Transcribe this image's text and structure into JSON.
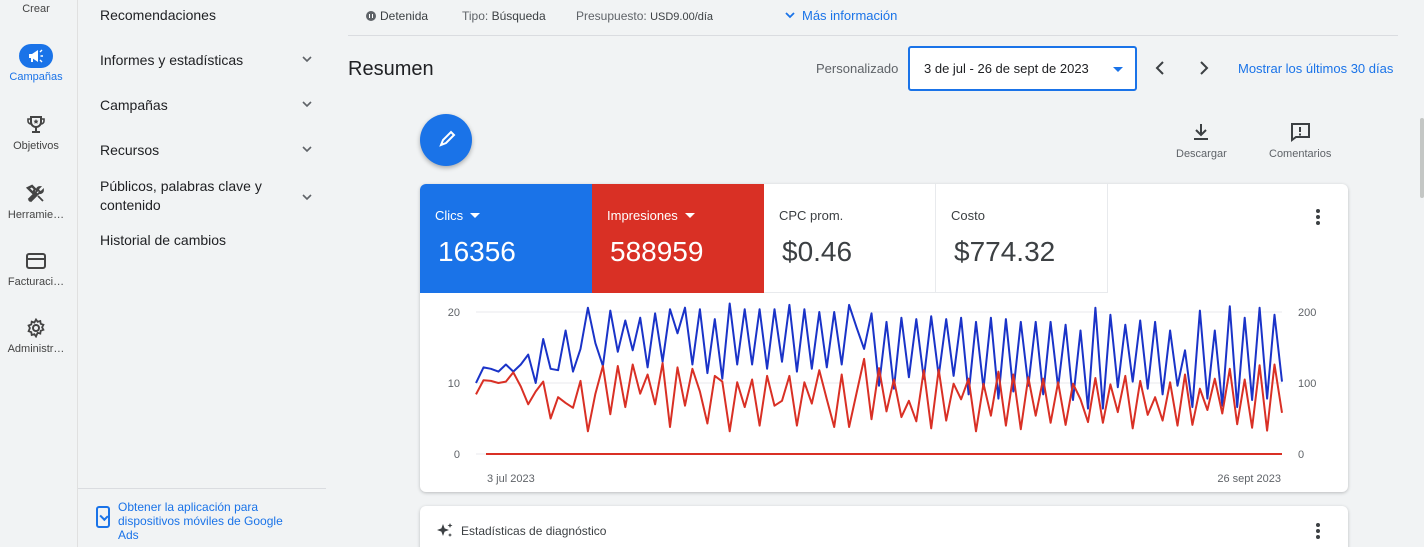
{
  "rail": {
    "items": [
      {
        "label": "Crear",
        "icon": "plus-icon"
      },
      {
        "label": "Campañas",
        "icon": "megaphone-icon"
      },
      {
        "label": "Objetivos",
        "icon": "trophy-icon"
      },
      {
        "label": "Herramie…",
        "icon": "tools-icon"
      },
      {
        "label": "Facturaci…",
        "icon": "credit-card-icon"
      },
      {
        "label": "Administr…",
        "icon": "gear-icon"
      }
    ]
  },
  "nav": {
    "items": [
      {
        "label": "Recomendaciones"
      },
      {
        "label": "Informes y estadísticas"
      },
      {
        "label": "Campañas"
      },
      {
        "label": "Recursos"
      },
      {
        "label": "Públicos, palabras clave y contenido"
      },
      {
        "label": "Historial de cambios"
      }
    ],
    "app_link": "Obtener la aplicación para dispositivos móviles de Google Ads"
  },
  "status": {
    "state": "Detenida",
    "type_label": "Tipo:",
    "type_value": "Búsqueda",
    "budget_label": "Presupuesto:",
    "budget_value": "USD9.00/día",
    "more": "Más información"
  },
  "header": {
    "title": "Resumen",
    "custom_label": "Personalizado",
    "date_range": "3 de jul - 26 de sept de 2023",
    "last30": "Mostrar los últimos 30 días"
  },
  "tools": {
    "download": "Descargar",
    "comments": "Comentarios"
  },
  "metrics": [
    {
      "name": "Clics",
      "value": "16356",
      "color": "#1a73e8"
    },
    {
      "name": "Impresiones",
      "value": "588959",
      "color": "#d93025"
    },
    {
      "name": "CPC prom.",
      "value": "$0.46"
    },
    {
      "name": "Costo",
      "value": "$774.32"
    }
  ],
  "chart_data": {
    "type": "line",
    "x_labels": [
      "3 jul 2023",
      "26 sept 2023"
    ],
    "left_axis": {
      "ticks": [
        "0",
        "10",
        "20"
      ],
      "range": [
        0,
        20
      ]
    },
    "right_axis": {
      "ticks": [
        "0",
        "100",
        "200"
      ],
      "range": [
        0,
        200
      ]
    },
    "series": [
      {
        "name": "Clics",
        "axis": "left",
        "color": "#1a33c8",
        "values": [
          10,
          12.2,
          12,
          11.6,
          12.6,
          11.6,
          12.6,
          14,
          10,
          16.2,
          12,
          11.8,
          17.4,
          11.6,
          14.8,
          20.6,
          15.6,
          12.4,
          20.2,
          14.4,
          18.8,
          14.6,
          19.2,
          12.2,
          19.8,
          13,
          20.4,
          17,
          20.6,
          12.6,
          20.4,
          11.4,
          19,
          10.6,
          21.2,
          12.6,
          20.4,
          12.6,
          20.4,
          12,
          20.4,
          13,
          21,
          11.6,
          20.4,
          12,
          20,
          12.2,
          20,
          12.6,
          21,
          17.8,
          14.8,
          19.8,
          9.6,
          18.6,
          9.2,
          19.2,
          10.8,
          19,
          10.6,
          19.4,
          11,
          19,
          11,
          19.2,
          8.4,
          18.6,
          9.2,
          19.2,
          7.8,
          19,
          8.8,
          18.6,
          9.6,
          18.6,
          8.4,
          18.6,
          9.4,
          18.2,
          7.6,
          17.4,
          6.4,
          20.6,
          6.4,
          19.6,
          9.4,
          18.2,
          10.2,
          18.8,
          9.2,
          18.6,
          8.4,
          17.4,
          9.6,
          14.6,
          6.6,
          20.2,
          7.8,
          17.4,
          6.8,
          20.8,
          6.6,
          19.2,
          7.6,
          20.6,
          7.8,
          19.6,
          10.2
        ]
      },
      {
        "name": "Impresiones",
        "axis": "right",
        "color": "#d93025",
        "values": [
          84,
          104,
          103,
          100,
          102,
          115,
          95,
          70,
          88,
          102,
          50,
          80,
          72,
          65,
          103,
          32,
          85,
          124,
          56,
          124,
          66,
          126,
          85,
          112,
          70,
          128,
          38,
          122,
          68,
          120,
          88,
          43,
          110,
          102,
          32,
          101,
          66,
          105,
          40,
          110,
          68,
          75,
          110,
          40,
          101,
          71,
          118,
          77,
          38,
          112,
          38,
          86,
          134,
          49,
          121,
          60,
          105,
          52,
          75,
          46,
          118,
          36,
          119,
          47,
          99,
          77,
          106,
          32,
          99,
          54,
          116,
          40,
          112,
          35,
          108,
          54,
          106,
          44,
          101,
          41,
          99,
          77,
          45,
          107,
          44,
          98,
          59,
          110,
          36,
          103,
          55,
          80,
          47,
          101,
          40,
          112,
          41,
          92,
          62,
          106,
          57,
          120,
          42,
          105,
          37,
          125,
          33,
          126,
          58
        ]
      }
    ]
  },
  "diagnostics": {
    "title": "Estadísticas de diagnóstico"
  }
}
